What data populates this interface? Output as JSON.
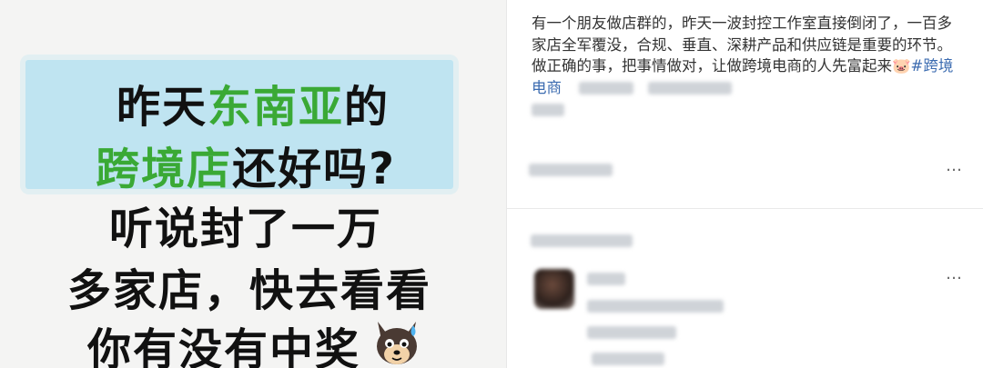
{
  "image_text": {
    "line1_a": "昨天",
    "line1_b": "东南亚",
    "line1_c": "的",
    "line2_a": "跨境店",
    "line2_b": "还好吗?",
    "line3": "听说封了一万",
    "line4": "多家店，快去看看",
    "line5": "你有没有中奖"
  },
  "post": {
    "text": "有一个朋友做店群的，昨天一波封控工作室直接倒闭了，一百多家店全军覆没，合规、垂直、深耕产品和供应链是重要的环节。做正确的事，把事情做对，让做跨境电商的人先富起来",
    "emoji": "🐷",
    "hashtag": "#跨境电商"
  },
  "actions": {
    "more_1": "…",
    "more_2": "…"
  },
  "icons": {
    "sticker": "dog-sweat-emoji",
    "post_emoji": "pig-emoji",
    "more": "more-options-icon"
  },
  "colors": {
    "highlight": "#bfe4f1",
    "green_text": "#3aa935",
    "hashtag": "#3b6bb0"
  }
}
